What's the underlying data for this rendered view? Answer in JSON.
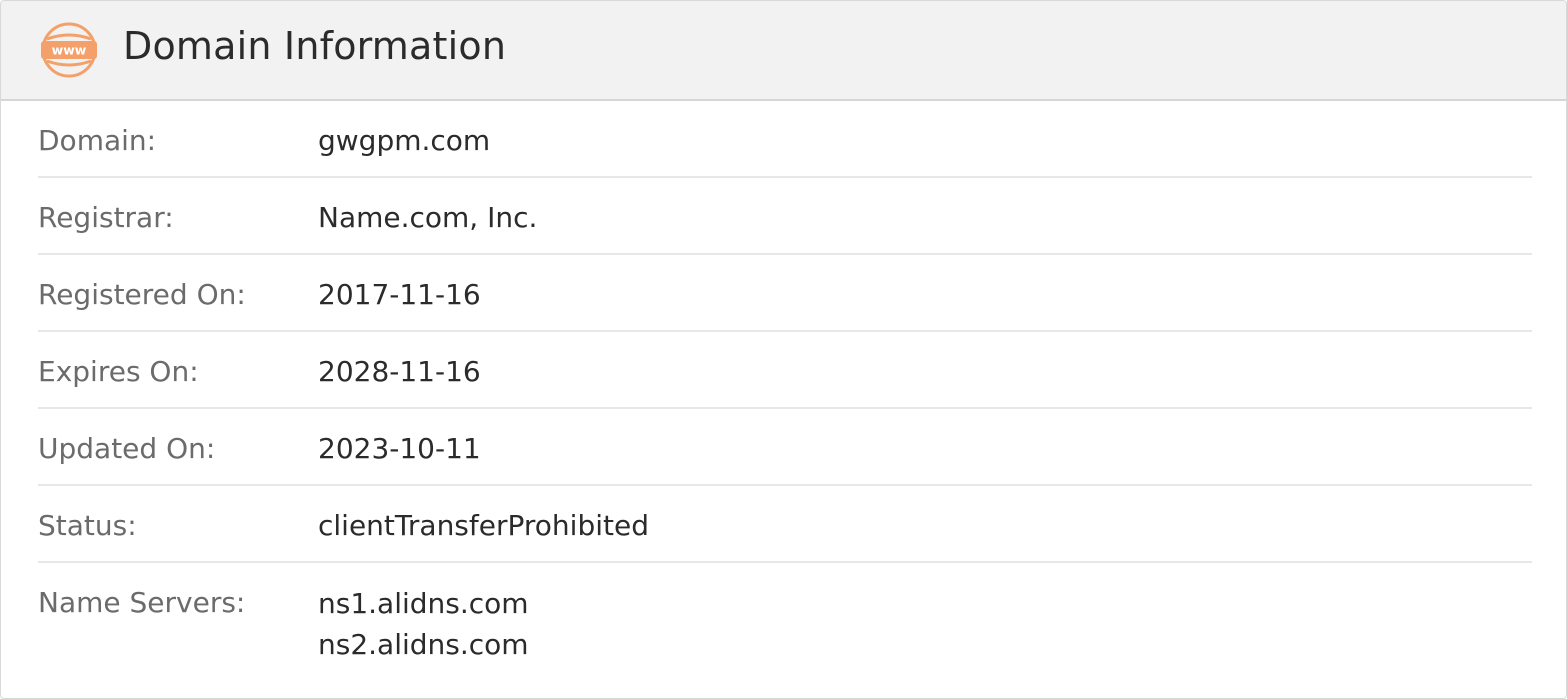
{
  "header": {
    "title": "Domain Information",
    "icon": "www-globe-icon",
    "icon_text": "www",
    "accent_color": "#f4a06a"
  },
  "rows": {
    "domain": {
      "label": "Domain:",
      "value": "gwgpm.com"
    },
    "registrar": {
      "label": "Registrar:",
      "value": "Name.com, Inc."
    },
    "registered_on": {
      "label": "Registered On:",
      "value": "2017-11-16"
    },
    "expires_on": {
      "label": "Expires On:",
      "value": "2028-11-16"
    },
    "updated_on": {
      "label": "Updated On:",
      "value": "2023-10-11"
    },
    "status": {
      "label": "Status:",
      "value": "clientTransferProhibited"
    },
    "name_servers": {
      "label": "Name Servers:",
      "values": [
        "ns1.alidns.com",
        "ns2.alidns.com"
      ]
    }
  }
}
